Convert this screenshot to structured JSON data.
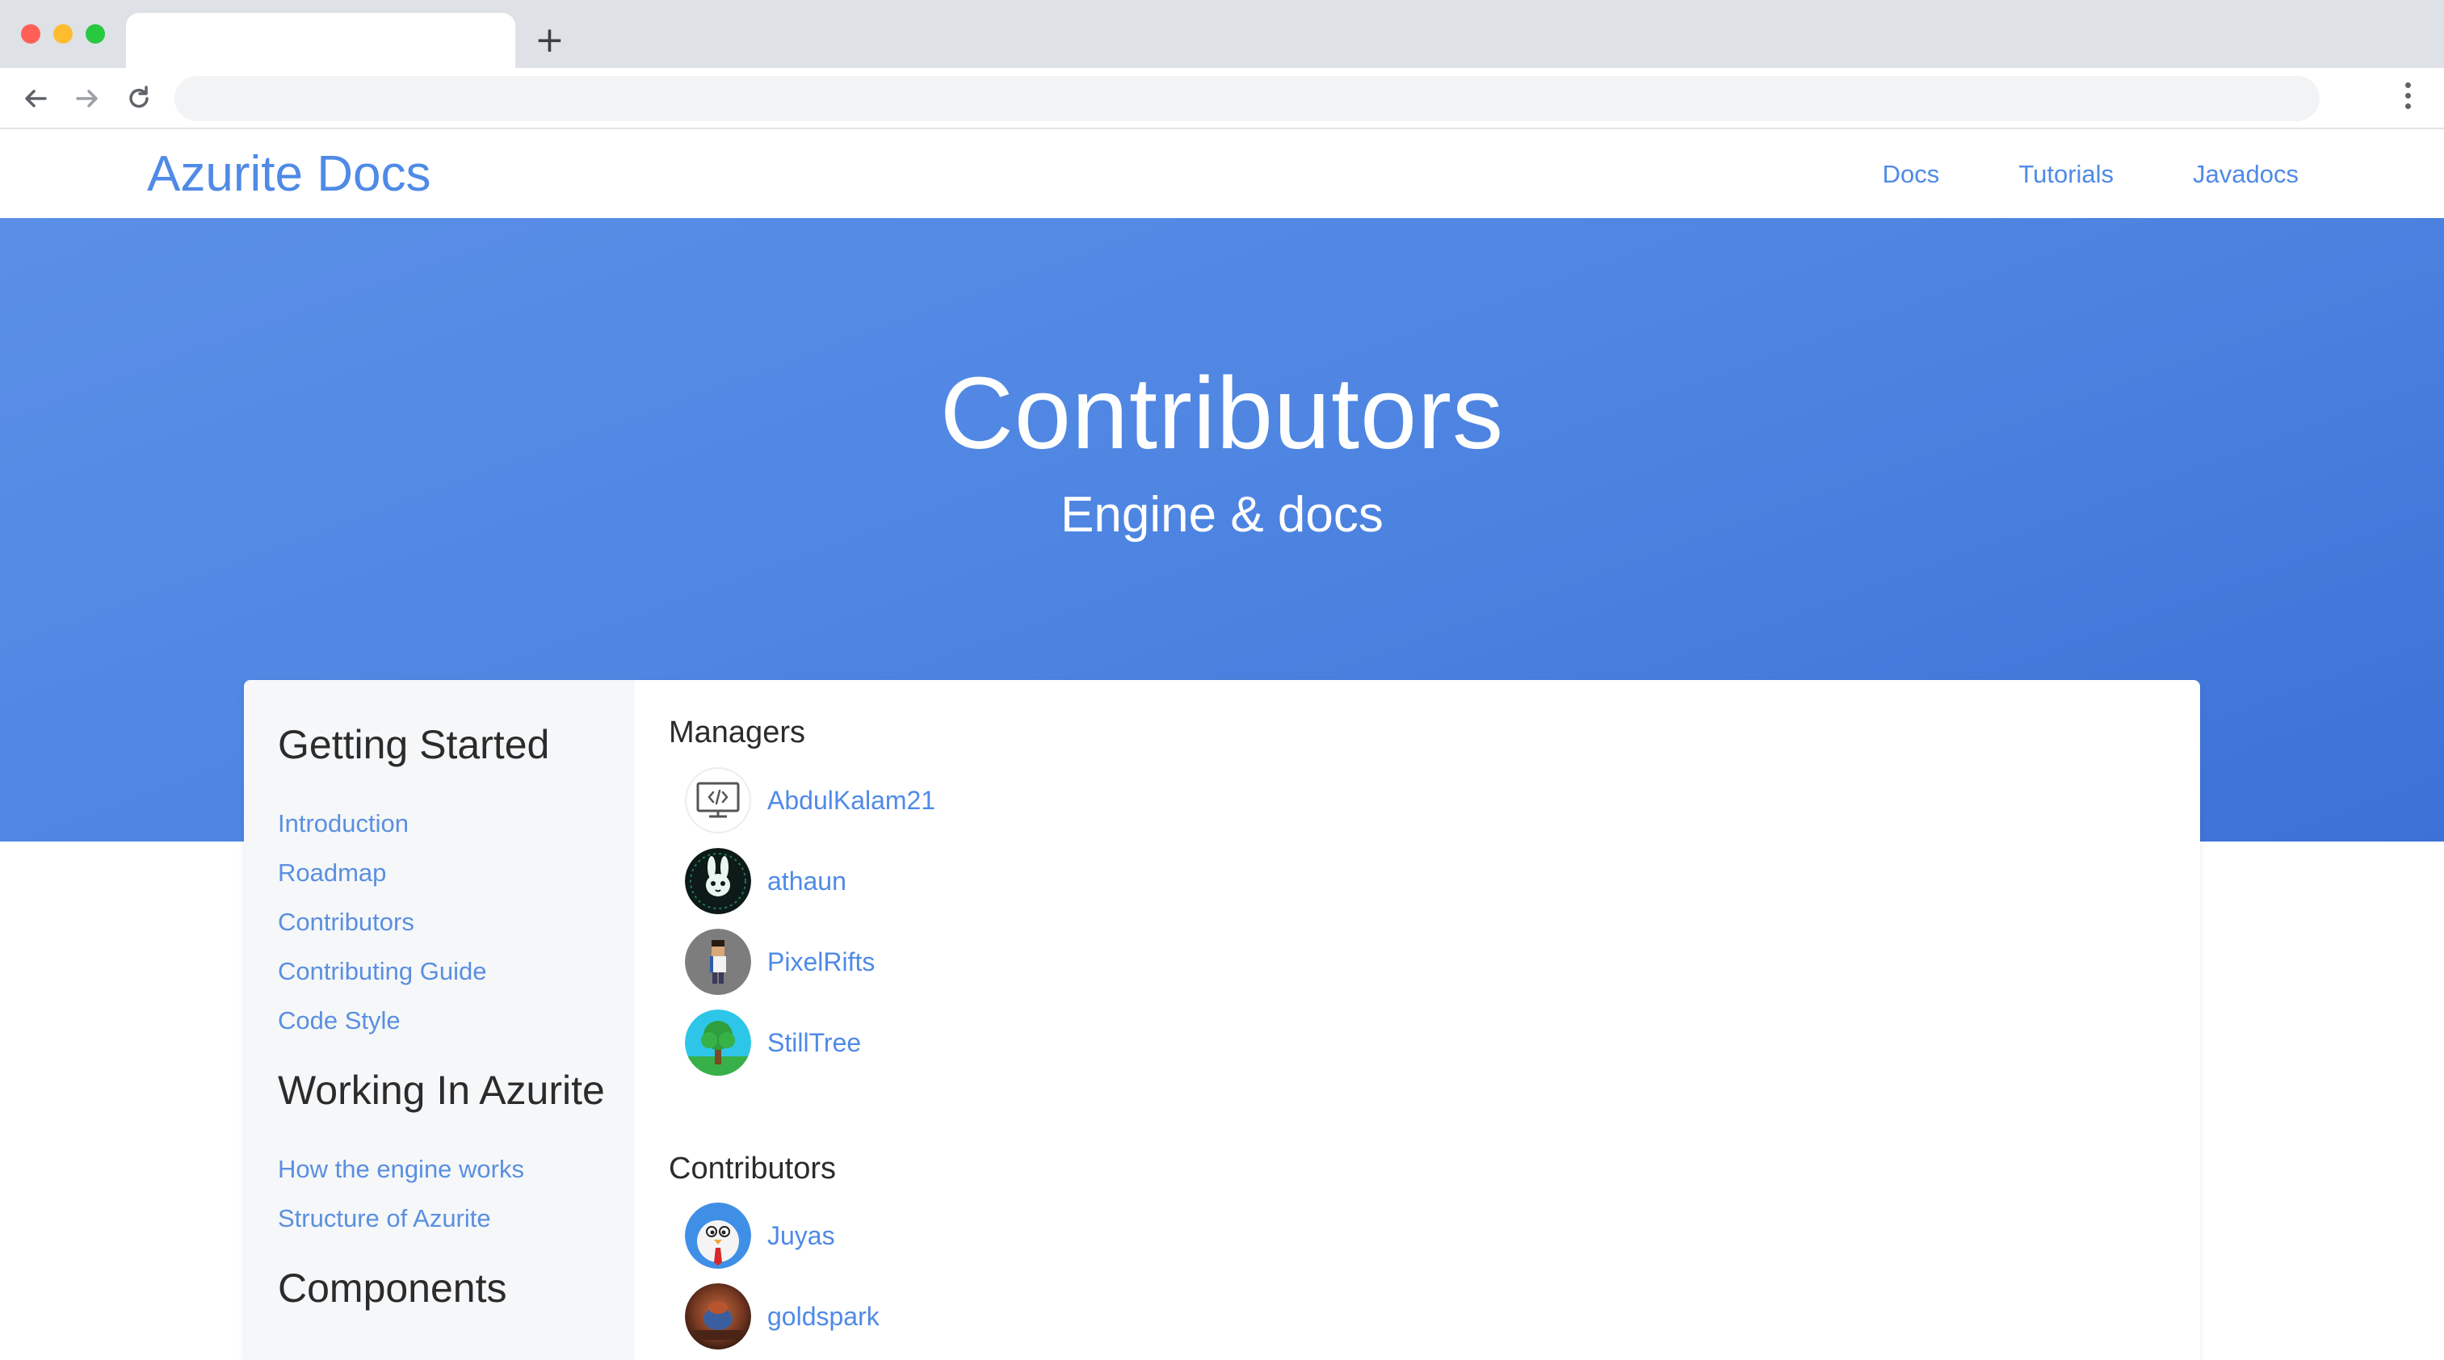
{
  "browser": {
    "new_tab_glyph": "+",
    "back_icon": "arrow-left-icon",
    "forward_icon": "arrow-right-icon",
    "reload_icon": "reload-icon",
    "url": "",
    "tab_title": ""
  },
  "site": {
    "brand": "Azurite Docs",
    "nav": [
      "Docs",
      "Tutorials",
      "Javadocs"
    ],
    "accent_color": "#4f8ae6"
  },
  "hero": {
    "title": "Contributors",
    "subtitle": "Engine & docs",
    "gradient": [
      "#5b8fe7",
      "#3d71d6"
    ]
  },
  "sidebar": {
    "sections": [
      {
        "heading": "Getting Started",
        "links": [
          "Introduction",
          "Roadmap",
          "Contributors",
          "Contributing Guide",
          "Code Style"
        ]
      },
      {
        "heading": "Working In Azurite",
        "links": [
          "How the engine works",
          "Structure of Azurite"
        ]
      },
      {
        "heading": "Components",
        "links": []
      }
    ]
  },
  "main": {
    "managers_title": "Managers",
    "managers": [
      {
        "name": "AbdulKalam21",
        "avatar": "code-monitor-avatar"
      },
      {
        "name": "athaun",
        "avatar": "rabbit-avatar"
      },
      {
        "name": "PixelRifts",
        "avatar": "pixel-character-avatar"
      },
      {
        "name": "StillTree",
        "avatar": "tree-avatar"
      }
    ],
    "contributors_title": "Contributors",
    "contributors": [
      {
        "name": "Juyas",
        "avatar": "cartoon-bird-avatar"
      },
      {
        "name": "goldspark",
        "avatar": "photo-avatar"
      }
    ]
  }
}
